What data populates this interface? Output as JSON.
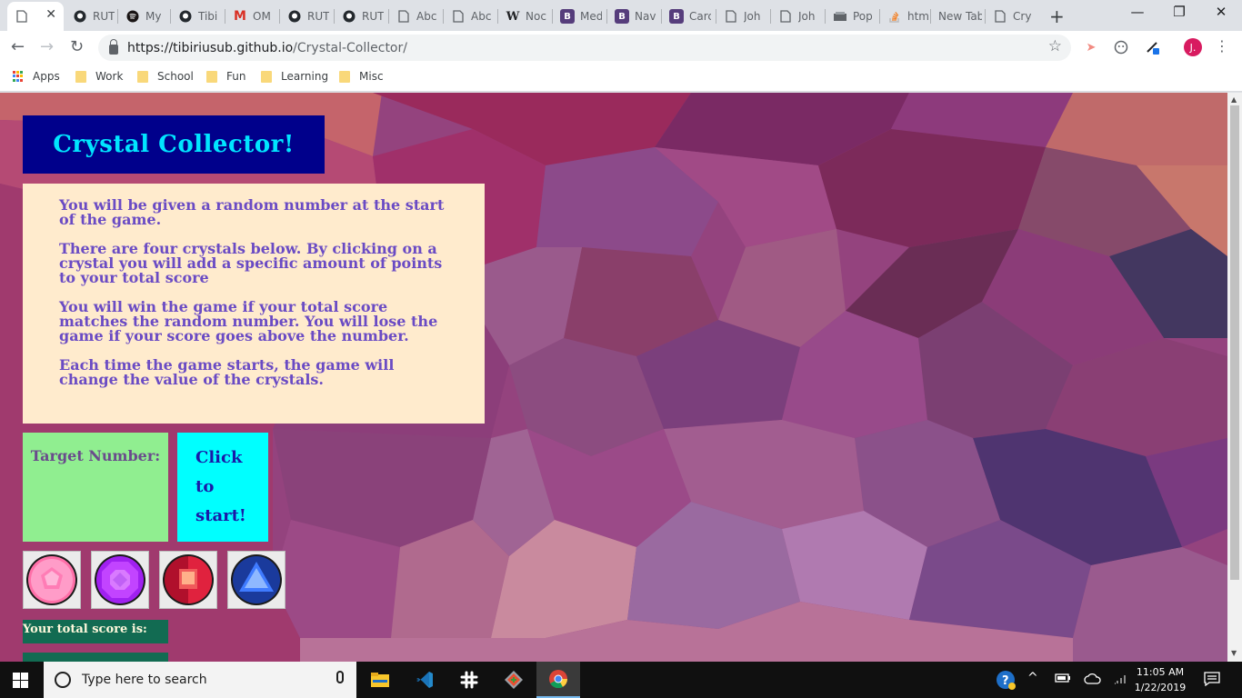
{
  "browser": {
    "tabs": [
      {
        "title": "",
        "icon": "page-icon",
        "active": true
      },
      {
        "title": "RUT",
        "icon": "github-icon"
      },
      {
        "title": "My",
        "icon": "spotify-icon"
      },
      {
        "title": "Tibi",
        "icon": "github-icon"
      },
      {
        "title": "OM",
        "icon": "gmail-icon"
      },
      {
        "title": "RUT",
        "icon": "github-icon"
      },
      {
        "title": "RUT",
        "icon": "github-icon"
      },
      {
        "title": "Abc",
        "icon": "page-icon"
      },
      {
        "title": "Abc",
        "icon": "page-icon"
      },
      {
        "title": "Noc",
        "icon": "wikipedia-icon"
      },
      {
        "title": "Med",
        "icon": "bootstrap-icon"
      },
      {
        "title": "Nav",
        "icon": "bootstrap-icon"
      },
      {
        "title": "Carc",
        "icon": "bootstrap-icon"
      },
      {
        "title": "Joh",
        "icon": "page-icon"
      },
      {
        "title": "Joh",
        "icon": "page-icon"
      },
      {
        "title": "Pop",
        "icon": "popup-icon"
      },
      {
        "title": "htm",
        "icon": "stackoverflow-icon"
      },
      {
        "title": "New Tab",
        "icon": ""
      },
      {
        "title": "Cry",
        "icon": "page-icon"
      }
    ],
    "url_host": "https://tibiriusub.github.io",
    "url_path": "/Crystal-Collector/",
    "avatar_letter": "J.",
    "bookmarks": [
      "Apps",
      "Work",
      "School",
      "Fun",
      "Learning",
      "Misc"
    ]
  },
  "page": {
    "title": "Crystal Collector!",
    "instructions": [
      "You will be given a random number at the start of the game.",
      "There are four crystals below. By clicking on a crystal you will add a specific amount of points to your total score",
      "You will win the game if your total score matches the random number. You will lose the game if your score goes above the number.",
      "Each time the game starts, the game will change the value of the crystals."
    ],
    "target_label": "Target Number:",
    "start_words": [
      "Click",
      "to",
      "start!"
    ],
    "crystals": [
      "pink-crystal",
      "purple-crystal",
      "red-crystal",
      "blue-crystal"
    ],
    "score_label": "Your total score is:"
  },
  "taskbar": {
    "search_placeholder": "Type here to search",
    "time": "11:05 AM",
    "date": "1/22/2019"
  },
  "colors": {
    "title_bg": "#00008b",
    "title_text": "#00e5ff",
    "instructions_bg": "#ffebcd",
    "instructions_text": "#6a4bc4",
    "target_bg": "#90ee90",
    "start_bg": "#00ffff",
    "score_bg": "#126b52"
  }
}
